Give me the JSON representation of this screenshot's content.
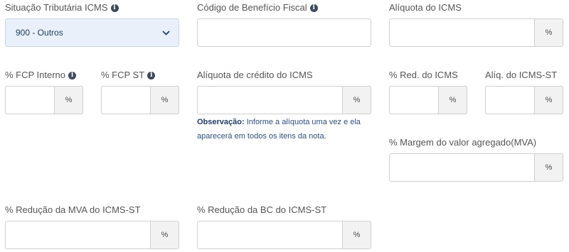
{
  "situacao": {
    "label": "Situação Tributária ICMS",
    "selected": "900 - Outros"
  },
  "codigo_beneficio": {
    "label": "Código de Benefício Fiscal",
    "value": ""
  },
  "aliquota_icms": {
    "label": "Alíquota do ICMS",
    "addon": "%"
  },
  "fcp_interno": {
    "label": "% FCP Interno",
    "addon": "%"
  },
  "fcp_st": {
    "label": "% FCP ST",
    "addon": "%"
  },
  "aliquota_credito": {
    "label": "Alíquota de crédito do ICMS",
    "addon": "%"
  },
  "observacao": {
    "label": "Observação:",
    "text": " Informe a alíquota uma vez e ela aparecerá em todos os itens da nota."
  },
  "red_icms": {
    "label": "% Red. do ICMS",
    "addon": "%"
  },
  "aliq_icms_st": {
    "label": "Alíq. do ICMS-ST",
    "addon": "%"
  },
  "margem_mva": {
    "label": "% Margem do valor agregado(MVA)",
    "addon": "%"
  },
  "reducao_mva": {
    "label": "% Redução da MVA do ICMS-ST",
    "addon": "%"
  },
  "reducao_bc": {
    "label": "% Redução da BC do ICMS-ST",
    "addon": "%"
  },
  "icons": {
    "info": "info-circle-icon",
    "dropdown": "chevron-down-icon"
  },
  "colors": {
    "select_bg": "#e9f0fa",
    "addon_bg": "#f2f2f2",
    "link_text": "#2e4e7b"
  }
}
